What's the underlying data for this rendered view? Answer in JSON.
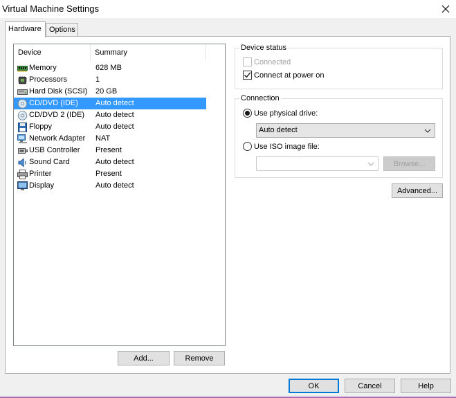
{
  "window": {
    "title": "Virtual Machine Settings"
  },
  "tabs": [
    {
      "label": "Hardware",
      "active": true
    },
    {
      "label": "Options",
      "active": false
    }
  ],
  "device_list": {
    "columns": [
      "Device",
      "Summary"
    ],
    "items": [
      {
        "name": "Memory",
        "summary": "628 MB",
        "icon": "memory-icon"
      },
      {
        "name": "Processors",
        "summary": "1",
        "icon": "processor-icon"
      },
      {
        "name": "Hard Disk (SCSI)",
        "summary": "20 GB",
        "icon": "hard-disk-icon"
      },
      {
        "name": "CD/DVD (IDE)",
        "summary": "Auto detect",
        "icon": "cd-dvd-icon",
        "selected": true
      },
      {
        "name": "CD/DVD 2 (IDE)",
        "summary": "Auto detect",
        "icon": "cd-dvd-icon"
      },
      {
        "name": "Floppy",
        "summary": "Auto detect",
        "icon": "floppy-icon"
      },
      {
        "name": "Network Adapter",
        "summary": "NAT",
        "icon": "network-adapter-icon"
      },
      {
        "name": "USB Controller",
        "summary": "Present",
        "icon": "usb-icon"
      },
      {
        "name": "Sound Card",
        "summary": "Auto detect",
        "icon": "sound-card-icon"
      },
      {
        "name": "Printer",
        "summary": "Present",
        "icon": "printer-icon"
      },
      {
        "name": "Display",
        "summary": "Auto detect",
        "icon": "display-icon"
      }
    ],
    "add_label": "Add...",
    "remove_label": "Remove"
  },
  "device_status": {
    "legend": "Device status",
    "connected_label": "Connected",
    "connected_checked": false,
    "connect_at_power_on_label": "Connect at power on",
    "connect_at_power_on_checked": true
  },
  "connection": {
    "legend": "Connection",
    "physical_drive_label": "Use physical drive:",
    "physical_drive_selected": true,
    "physical_drive_value": "Auto detect",
    "iso_label": "Use ISO image file:",
    "iso_value": "",
    "browse_label": "Browse..."
  },
  "advanced_label": "Advanced...",
  "footer": {
    "ok_label": "OK",
    "cancel_label": "Cancel",
    "help_label": "Help"
  },
  "colors": {
    "selection": "#3399ff",
    "default_button_border": "#0078d7",
    "window_bottom_accent": "#a56fb1"
  }
}
